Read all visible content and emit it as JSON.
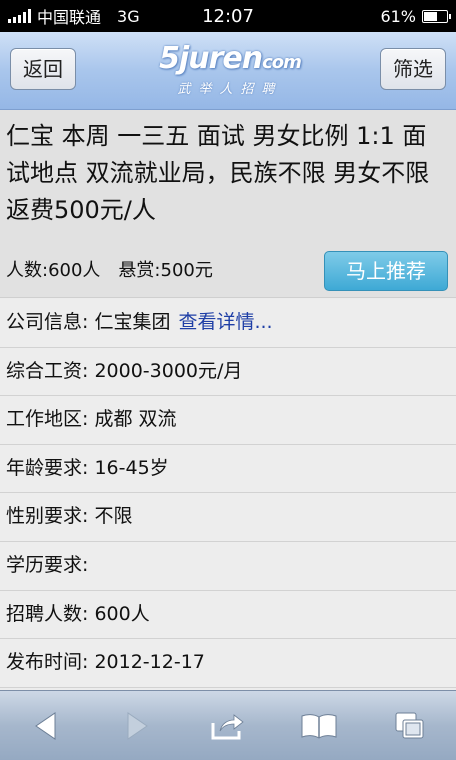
{
  "status_bar": {
    "carrier": "中国联通",
    "network": "3G",
    "time": "12:07",
    "battery": "61%",
    "battery_level": 0.61
  },
  "navbar": {
    "back_label": "返回",
    "filter_label": "筛选",
    "logo_text": "5juren",
    "logo_suffix": "com",
    "logo_sub": "武举人招聘"
  },
  "headline": {
    "title": "仁宝 本周 一三五 面试 男女比例 1:1 面试地点 双流就业局，民族不限 男女不限 返费500元/人",
    "headcount": "人数:600人",
    "reward": "悬赏:500元",
    "recommend_label": "马上推荐"
  },
  "info": [
    {
      "label": "公司信息:",
      "value": "仁宝集团",
      "link": "查看详情..."
    },
    {
      "label": "综合工资:",
      "value": "2000-3000元/月"
    },
    {
      "label": "工作地区:",
      "value": "成都 双流"
    },
    {
      "label": "年龄要求:",
      "value": "16-45岁"
    },
    {
      "label": "性别要求:",
      "value": "不限"
    },
    {
      "label": "学历要求:",
      "value": ""
    },
    {
      "label": "招聘人数:",
      "value": "600人"
    },
    {
      "label": "发布时间:",
      "value": "2012-12-17"
    }
  ],
  "toolbar": {
    "icons": [
      "back-arrow-icon",
      "forward-arrow-icon",
      "share-icon",
      "bookmarks-icon",
      "tabs-icon"
    ]
  },
  "colors": {
    "nav_gradient_top": "#cfe0f6",
    "nav_gradient_bottom": "#95b7e6",
    "accent_button": "#3ea9d5",
    "link": "#1f3fa6"
  }
}
